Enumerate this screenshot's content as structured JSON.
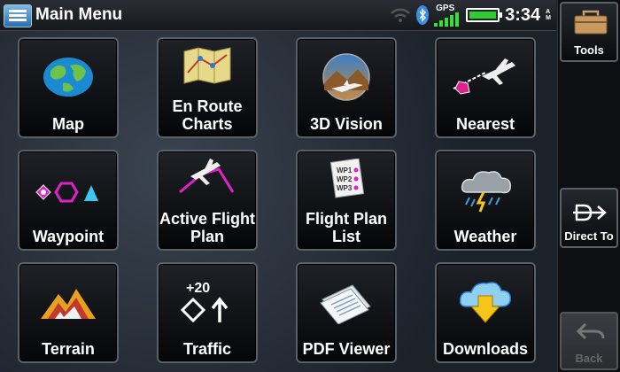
{
  "header": {
    "title": "Main Menu",
    "gps_label": "GPS",
    "time": "3:34",
    "am": "A",
    "pm": "M"
  },
  "tiles": [
    {
      "label": "Map",
      "icon": "globe-icon"
    },
    {
      "label": "En Route Charts",
      "icon": "chart-map-icon"
    },
    {
      "label": "3D Vision",
      "icon": "3d-vision-icon"
    },
    {
      "label": "Nearest",
      "icon": "nearest-airport-icon"
    },
    {
      "label": "Waypoint",
      "icon": "waypoint-symbols-icon"
    },
    {
      "label": "Active Flight Plan",
      "icon": "flight-plan-route-icon"
    },
    {
      "label": "Flight Plan List",
      "icon": "flight-plan-list-icon"
    },
    {
      "label": "Weather",
      "icon": "weather-cloud-icon"
    },
    {
      "label": "Terrain",
      "icon": "terrain-icon"
    },
    {
      "label": "Traffic",
      "icon": "traffic-icon",
      "icon_text": "+20"
    },
    {
      "label": "PDF Viewer",
      "icon": "documents-icon"
    },
    {
      "label": "Downloads",
      "icon": "download-cloud-icon"
    }
  ],
  "icon_text": {
    "wpt1": "WP1",
    "wpt2": "WP2",
    "wpt3": "WP3"
  },
  "sidebar": {
    "tools": "Tools",
    "direct_to": "Direct To",
    "back": "Back"
  }
}
